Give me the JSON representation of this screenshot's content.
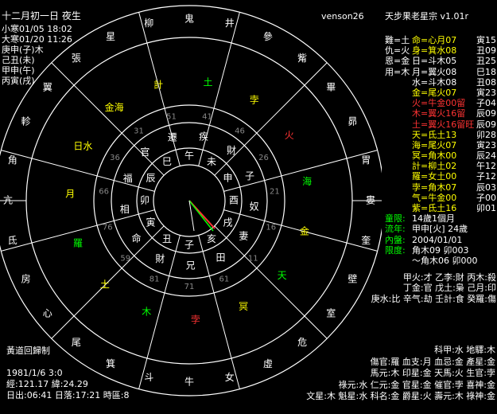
{
  "header": {
    "lunar_date": "十二月初一日 夜生",
    "author": "venson26",
    "app_title": "天步果老星宗 v1.01r"
  },
  "left_info": {
    "lines": [
      "小寒01/05 18:02",
      "大寒01/20 11:26",
      "庚申(子)木",
      "己丑(未)",
      "甲申(午)",
      "丙寅(戌)"
    ]
  },
  "right_panel": {
    "role_lines": [
      {
        "label": "難=土",
        "value": "命=心月07",
        "tail": "寅15",
        "color": "#ff0"
      },
      {
        "label": "仇=火",
        "value": "身=箕水08",
        "tail": "丑09",
        "color": "#ff0"
      },
      {
        "label": "恩=金",
        "value": "日=斗木05",
        "tail": "丑25",
        "color": "#fff"
      },
      {
        "label": "用=木",
        "value": "月=翼火08",
        "tail": "巳18",
        "color": "#fff"
      },
      {
        "label": "",
        "value": "水=斗木08",
        "tail": "丑08",
        "color": "#fff"
      },
      {
        "label": "",
        "value": "金=尾火07",
        "tail": "寅23",
        "color": "#ff0"
      },
      {
        "label": "",
        "value": "火=牛金00留",
        "tail": "子04",
        "color": "#f33"
      },
      {
        "label": "",
        "value": "木=翼火16留",
        "tail": "辰09",
        "color": "#f33"
      },
      {
        "label": "",
        "value": "土=翼火16留旺",
        "tail": "辰09",
        "color": "#f33"
      },
      {
        "label": "",
        "value": "天=氐土13",
        "tail": "卯28",
        "color": "#ff0"
      },
      {
        "label": "",
        "value": "海=尾火07",
        "tail": "寅23",
        "color": "#ff0"
      },
      {
        "label": "",
        "value": "冥=角木00",
        "tail": "辰24",
        "color": "#ff0"
      },
      {
        "label": "",
        "value": "計=柳土02",
        "tail": "午12",
        "color": "#ff0"
      },
      {
        "label": "",
        "value": "羅=女土00",
        "tail": "子12",
        "color": "#ff0"
      },
      {
        "label": "",
        "value": "孛=角木07",
        "tail": "辰03",
        "color": "#ff0"
      },
      {
        "label": "",
        "value": "气=牛金00",
        "tail": "子00",
        "color": "#ff0"
      },
      {
        "label": "",
        "value": "紫=氐土16",
        "tail": "卯01",
        "color": "#ff0"
      }
    ],
    "limits": [
      {
        "k": "童限:",
        "v": "14歲1個月",
        "color": "#0f0"
      },
      {
        "k": "流年:",
        "v": "甲申[火] 24歲",
        "color": "#0f0"
      },
      {
        "k": "內盤:",
        "v": "2004/01/01",
        "color": "#0f0"
      },
      {
        "k": "限度:",
        "v": "角木09 卯003",
        "color": "#0f0"
      },
      {
        "k": "",
        "v": "～角木06 卯000",
        "color": "#fff"
      }
    ],
    "gods": [
      "甲火:才 乙李:財 丙木:殺",
      "丁金:官 戊土:梟 己月:印",
      "庚水:比 辛气:劫 壬計:食 癸羅:傷"
    ],
    "stars": [
      "科甲:水 地驛:木",
      "傷官:羅 血支:月 血忌:金 產星:金",
      "馬元:木 印星:金 天馬:火 生官:孛",
      "祿元:水 仁元:金 官星:金 催官:孛 喜神:金",
      "文星:木 魁星:水 科名:金 爵星:火 壽元:木 祿神:金"
    ]
  },
  "bottom_left": {
    "mode": "黃道回歸制",
    "birth": "1981/1/6 3:0",
    "coords": "經:121.17 緯:24.29",
    "sun": "日出:06:41 日落:17:21 時區:8"
  },
  "chart": {
    "center_branches": [
      "巳",
      "午",
      "未",
      "申",
      "酉",
      "戌",
      "亥",
      "子",
      "丑",
      "寅",
      "卯",
      "辰"
    ],
    "palaces": [
      "遷",
      "疾",
      "財",
      "子",
      "奴",
      "妻",
      "田",
      "兄",
      "財",
      "命",
      "相",
      "福",
      "官"
    ],
    "mansions": [
      "鬼",
      "井",
      "參",
      "觜",
      "畢",
      "昴",
      "胃",
      "婁",
      "奎",
      "壁",
      "室",
      "危",
      "虛",
      "女",
      "牛",
      "斗",
      "箕",
      "尾",
      "心",
      "房",
      "氐",
      "亢",
      "角",
      "軫",
      "翼",
      "張",
      "星",
      "柳"
    ],
    "planets_outer": [
      "計",
      "土",
      "孛",
      "火",
      "海",
      "金",
      "天",
      "冥",
      "孛",
      "木",
      "土",
      "羅",
      "月",
      "日水",
      "金海"
    ],
    "ages": [
      "36",
      "31",
      "51",
      "41",
      "46",
      "26",
      "21",
      "16",
      "11",
      "61",
      "71",
      "81",
      "59",
      "76",
      "66"
    ],
    "colors": {
      "gold": "#ff0",
      "green": "#0f0",
      "red": "#f33",
      "white": "#fff"
    }
  }
}
